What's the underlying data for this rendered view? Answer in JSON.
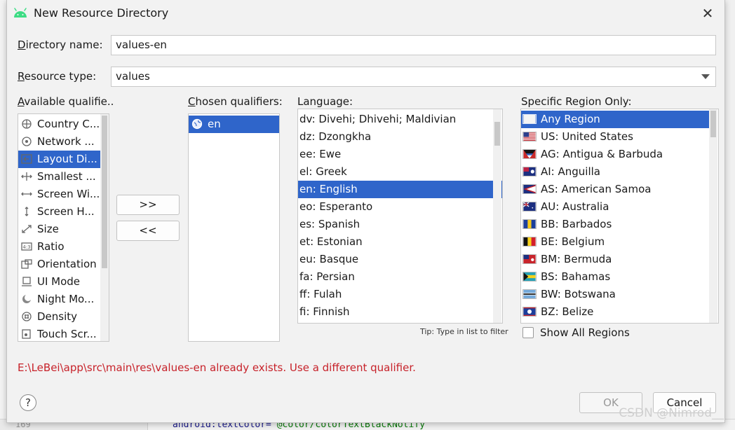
{
  "dialog": {
    "title": "New Resource Directory",
    "close_icon": "close-x"
  },
  "directory_name": {
    "label": "irectory name:",
    "label_mnemonic": "D",
    "value": "values-en"
  },
  "resource_type": {
    "label": "esource type:",
    "label_mnemonic": "R",
    "value": "values"
  },
  "available_qualifiers": {
    "label": "vailable qualifie..",
    "label_mnemonic": "A",
    "items": [
      {
        "label": "Country C...",
        "icon": "country-code-icon"
      },
      {
        "label": "Network ...",
        "icon": "network-code-icon"
      },
      {
        "label": "Layout Di...",
        "icon": "layout-direction-icon",
        "selected": true
      },
      {
        "label": "Smallest ...",
        "icon": "smallest-width-icon"
      },
      {
        "label": "Screen Wi...",
        "icon": "screen-width-icon"
      },
      {
        "label": "Screen H...",
        "icon": "screen-height-icon"
      },
      {
        "label": "Size",
        "icon": "size-icon"
      },
      {
        "label": "Ratio",
        "icon": "ratio-icon"
      },
      {
        "label": "Orientation",
        "icon": "orientation-icon"
      },
      {
        "label": "UI Mode",
        "icon": "ui-mode-icon"
      },
      {
        "label": "Night Mo...",
        "icon": "night-mode-icon"
      },
      {
        "label": "Density",
        "icon": "density-icon"
      },
      {
        "label": "Touch Scr...",
        "icon": "touch-screen-icon"
      }
    ]
  },
  "transfer": {
    "add_label": ">>",
    "remove_label": "<<"
  },
  "chosen_qualifiers": {
    "label": "hosen qualifiers:",
    "label_mnemonic": "C",
    "items": [
      {
        "label": "en",
        "icon": "globe-icon",
        "selected": true
      }
    ]
  },
  "language": {
    "label": "Language:",
    "items": [
      {
        "label": "dv: Divehi; Dhivehi; Maldivian"
      },
      {
        "label": "dz: Dzongkha"
      },
      {
        "label": "ee: Ewe"
      },
      {
        "label": "el: Greek"
      },
      {
        "label": "en: English",
        "selected": true
      },
      {
        "label": "eo: Esperanto"
      },
      {
        "label": "es: Spanish"
      },
      {
        "label": "et: Estonian"
      },
      {
        "label": "eu: Basque"
      },
      {
        "label": "fa: Persian"
      },
      {
        "label": "ff: Fulah"
      },
      {
        "label": "fi: Finnish"
      }
    ],
    "tip": "Tip: Type in list to filter"
  },
  "region": {
    "label": "Specific Region Only:",
    "items": [
      {
        "label": "Any Region",
        "flag": "blank-flag-icon",
        "selected": true
      },
      {
        "label": "US: United States",
        "flag": "us-flag-icon"
      },
      {
        "label": "AG: Antigua & Barbuda",
        "flag": "ag-flag-icon"
      },
      {
        "label": "AI: Anguilla",
        "flag": "ai-flag-icon"
      },
      {
        "label": "AS: American Samoa",
        "flag": "as-flag-icon"
      },
      {
        "label": "AU: Australia",
        "flag": "au-flag-icon"
      },
      {
        "label": "BB: Barbados",
        "flag": "bb-flag-icon"
      },
      {
        "label": "BE: Belgium",
        "flag": "be-flag-icon"
      },
      {
        "label": "BM: Bermuda",
        "flag": "bm-flag-icon"
      },
      {
        "label": "BS: Bahamas",
        "flag": "bs-flag-icon"
      },
      {
        "label": "BW: Botswana",
        "flag": "bw-flag-icon"
      },
      {
        "label": "BZ: Belize",
        "flag": "bz-flag-icon"
      }
    ],
    "show_all_label": "Show All Regions",
    "show_all_checked": false
  },
  "error_message": "E:\\LeBei\\app\\src\\main\\res\\values-en already exists. Use a different qualifier.",
  "footer": {
    "help_label": "?",
    "ok_label": "OK",
    "ok_enabled": false,
    "cancel_label": "Cancel"
  },
  "background_editor": {
    "line_number": "169",
    "code_attr": "android:textColor=",
    "code_value": "\"@color/colorTextBlackNotify\""
  },
  "watermark": "CSDN @Nimrod__",
  "colors": {
    "selection": "#2f65ca",
    "error": "#c7222a",
    "android_green": "#3ddc84"
  }
}
